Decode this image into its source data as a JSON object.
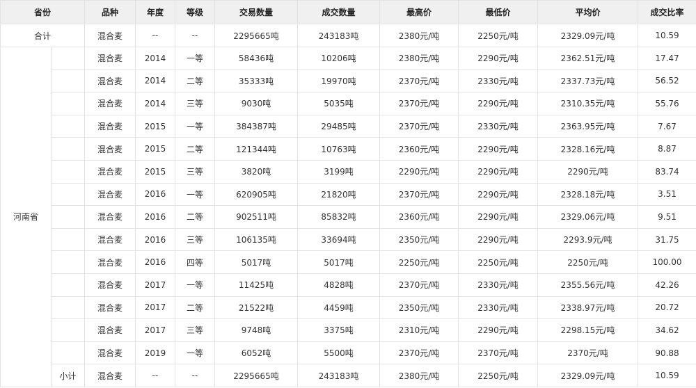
{
  "columns": [
    "省份",
    "品种",
    "年度",
    "等级",
    "交易数量",
    "成交数量",
    "最高价",
    "最低价",
    "平均价",
    "成交比率"
  ],
  "total": {
    "label": "合计",
    "cells": [
      "混合麦",
      "--",
      "--",
      "2295665吨",
      "243183吨",
      "2380元/吨",
      "2250元/吨",
      "2329.09元/吨",
      "10.59"
    ]
  },
  "province": "河南省",
  "rows": [
    [
      "混合麦",
      "2014",
      "一等",
      "58436吨",
      "10206吨",
      "2380元/吨",
      "2290元/吨",
      "2362.51元/吨",
      "17.47"
    ],
    [
      "混合麦",
      "2014",
      "二等",
      "35333吨",
      "19970吨",
      "2370元/吨",
      "2330元/吨",
      "2337.73元/吨",
      "56.52"
    ],
    [
      "混合麦",
      "2014",
      "三等",
      "9030吨",
      "5035吨",
      "2370元/吨",
      "2290元/吨",
      "2310.35元/吨",
      "55.76"
    ],
    [
      "混合麦",
      "2015",
      "一等",
      "384387吨",
      "29485吨",
      "2370元/吨",
      "2330元/吨",
      "2363.95元/吨",
      "7.67"
    ],
    [
      "混合麦",
      "2015",
      "二等",
      "121344吨",
      "10763吨",
      "2360元/吨",
      "2290元/吨",
      "2328.16元/吨",
      "8.87"
    ],
    [
      "混合麦",
      "2015",
      "三等",
      "3820吨",
      "3199吨",
      "2290元/吨",
      "2290元/吨",
      "2290元/吨",
      "83.74"
    ],
    [
      "混合麦",
      "2016",
      "一等",
      "620905吨",
      "21820吨",
      "2370元/吨",
      "2290元/吨",
      "2328.18元/吨",
      "3.51"
    ],
    [
      "混合麦",
      "2016",
      "二等",
      "902511吨",
      "85832吨",
      "2360元/吨",
      "2290元/吨",
      "2329.06元/吨",
      "9.51"
    ],
    [
      "混合麦",
      "2016",
      "三等",
      "106135吨",
      "33694吨",
      "2350元/吨",
      "2290元/吨",
      "2293.9元/吨",
      "31.75"
    ],
    [
      "混合麦",
      "2016",
      "四等",
      "5017吨",
      "5017吨",
      "2250元/吨",
      "2250元/吨",
      "2250元/吨",
      "100.00"
    ],
    [
      "混合麦",
      "2017",
      "一等",
      "11425吨",
      "4828吨",
      "2370元/吨",
      "2330元/吨",
      "2355.56元/吨",
      "42.26"
    ],
    [
      "混合麦",
      "2017",
      "二等",
      "21522吨",
      "4459吨",
      "2350元/吨",
      "2330元/吨",
      "2338.97元/吨",
      "20.72"
    ],
    [
      "混合麦",
      "2017",
      "三等",
      "9748吨",
      "3375吨",
      "2310元/吨",
      "2290元/吨",
      "2298.15元/吨",
      "34.62"
    ],
    [
      "混合麦",
      "2019",
      "一等",
      "6052吨",
      "5500吨",
      "2370元/吨",
      "2370元/吨",
      "2370元/吨",
      "90.88"
    ]
  ],
  "subtotal": {
    "label": "小计",
    "cells": [
      "混合麦",
      "--",
      "--",
      "2295665吨",
      "243183吨",
      "2380元/吨",
      "2250元/吨",
      "2329.09元/吨",
      "10.59"
    ]
  }
}
